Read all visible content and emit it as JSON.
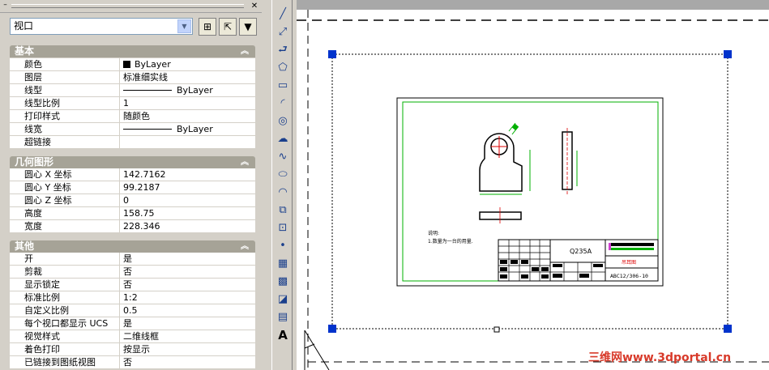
{
  "palette": {
    "selector_value": "视口",
    "sections": [
      {
        "title": "基本",
        "rows": [
          {
            "k": "颜色",
            "v": "ByLayer",
            "kind": "color"
          },
          {
            "k": "图层",
            "v": "标准细实线"
          },
          {
            "k": "线型",
            "v": "ByLayer",
            "kind": "line"
          },
          {
            "k": "线型比例",
            "v": "1"
          },
          {
            "k": "打印样式",
            "v": "随颜色"
          },
          {
            "k": "线宽",
            "v": "ByLayer",
            "kind": "line"
          },
          {
            "k": "超链接",
            "v": ""
          }
        ]
      },
      {
        "title": "几何图形",
        "rows": [
          {
            "k": "圆心 X 坐标",
            "v": "142.7162"
          },
          {
            "k": "圆心 Y 坐标",
            "v": "99.2187"
          },
          {
            "k": "圆心 Z 坐标",
            "v": "0"
          },
          {
            "k": "高度",
            "v": "158.75"
          },
          {
            "k": "宽度",
            "v": "228.346"
          }
        ]
      },
      {
        "title": "其他",
        "rows": [
          {
            "k": "开",
            "v": "是"
          },
          {
            "k": "剪裁",
            "v": "否"
          },
          {
            "k": "显示锁定",
            "v": "否"
          },
          {
            "k": "标准比例",
            "v": "1:2"
          },
          {
            "k": "自定义比例",
            "v": "0.5"
          },
          {
            "k": "每个视口都显示 UCS",
            "v": "是"
          },
          {
            "k": "视觉样式",
            "v": "二维线框"
          },
          {
            "k": "着色打印",
            "v": "按显示"
          },
          {
            "k": "已链接到图纸视图",
            "v": "否"
          }
        ]
      }
    ]
  },
  "drawing": {
    "material": "Q235A",
    "note_title": "说明:",
    "note_line": "1.数量为一台的用量.",
    "part_name": "吊耳图",
    "drawing_no": "ABC12/306-10"
  },
  "watermark": "三维网www.3dportal.cn",
  "colors": {
    "accent_green": "#00c000",
    "grip_blue": "#0033cc",
    "watermark_red": "#d83a2a"
  }
}
